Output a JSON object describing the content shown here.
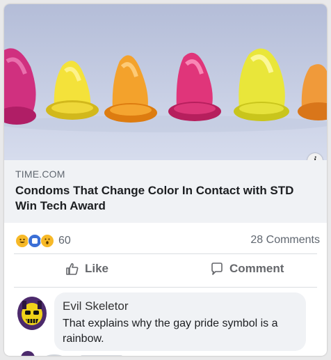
{
  "post": {
    "link_domain": "TIME.COM",
    "link_headline": "Condoms That Change Color In Contact with STD Win Tech Award",
    "reaction_count": "60",
    "reaction_icons": [
      "grin-react-icon",
      "blue-face-react-icon",
      "wow-react-icon"
    ],
    "comments_label": "28 Comments",
    "like_label": "Like",
    "comment_label": "Comment",
    "image_icons": [
      "info-icon"
    ]
  },
  "comment": {
    "author": "Evil Skeletor",
    "text": "That explains why the gay pride symbol is a rainbow."
  },
  "colors": {
    "link_bg": "#f0f2f5",
    "secondary_text": "#606770",
    "action_text": "#65676b",
    "reaction_yellow": "#f7b928",
    "reaction_blue": "#3b6fd6"
  },
  "hero_items": [
    "magenta",
    "yellow",
    "orange",
    "pink",
    "yellow",
    "orange"
  ]
}
